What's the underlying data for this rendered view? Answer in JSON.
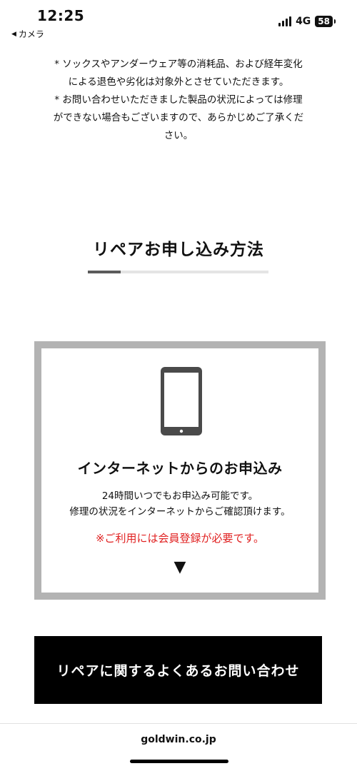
{
  "status_bar": {
    "time": "12:25",
    "back_app": "カメラ",
    "network": "4G",
    "battery": "58"
  },
  "notes": {
    "line1": "* ソックスやアンダーウェア等の消耗品、および経年変化",
    "line2": "による退色や劣化は対象外とさせていただきます。",
    "line3": "* お問い合わせいただきました製品の状況によっては修理",
    "line4": "ができない場合もございますので、あらかじめご了承くだ",
    "line5": "さい。"
  },
  "section": {
    "title": "リペアお申し込み方法",
    "progress": 0.18
  },
  "internet_card": {
    "icon": "smartphone-icon",
    "title": "インターネットからのお申込み",
    "desc_line1": "24時間いつでもお申込み可能です。",
    "desc_line2": "修理の状況をインターネットからご確認頂けます。",
    "notice": "※ご利用には会員登録が必要です。",
    "arrow": "▼"
  },
  "faq_button": {
    "label": "リペアに関するよくあるお問い合わせ"
  },
  "browser": {
    "domain": "goldwin.co.jp"
  },
  "colors": {
    "notice_red": "#e02020",
    "card_border": "#b3b3b3",
    "progress_fill": "#5b5b5b",
    "button_bg": "#000000"
  }
}
